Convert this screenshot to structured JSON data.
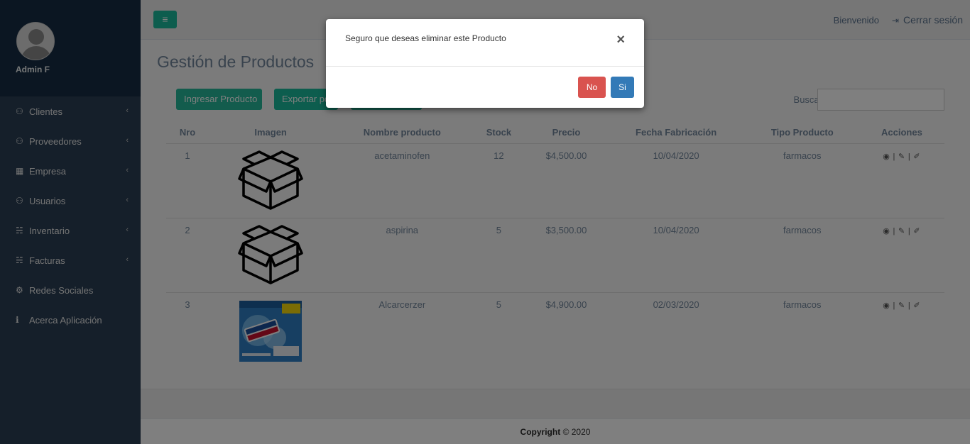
{
  "sidebar": {
    "user_name": "Admin F",
    "items": [
      {
        "label": "Clientes",
        "icon": "user-icon",
        "glyph": "⚇",
        "chevron": "‹"
      },
      {
        "label": "Proveedores",
        "icon": "user-icon",
        "glyph": "⚇",
        "chevron": "‹"
      },
      {
        "label": "Empresa",
        "icon": "building-icon",
        "glyph": "▦",
        "chevron": "‹"
      },
      {
        "label": "Usuarios",
        "icon": "user-icon",
        "glyph": "⚇",
        "chevron": "‹"
      },
      {
        "label": "Inventario",
        "icon": "cart-icon",
        "glyph": "☵",
        "chevron": "‹"
      },
      {
        "label": "Facturas",
        "icon": "cart-icon",
        "glyph": "☵",
        "chevron": "‹"
      },
      {
        "label": "Redes Sociales",
        "icon": "gear-icon",
        "glyph": "⚙",
        "chevron": ""
      },
      {
        "label": "Acerca Aplicación",
        "icon": "info-icon",
        "glyph": "ℹ",
        "chevron": ""
      }
    ]
  },
  "topbar": {
    "toggle_glyph": "≡",
    "welcome": "Bienvenido",
    "logout_glyph": "⇥",
    "logout": "Cerrar sesión"
  },
  "page": {
    "title": "Gestión de Productos",
    "btn_add": "Ingresar Producto",
    "btn_export": "Exportar pdf",
    "btn_other": "",
    "search_label": "Buscar",
    "search_value": ""
  },
  "table": {
    "headers": [
      "Nro",
      "Imagen",
      "Nombre producto",
      "Stock",
      "Precio",
      "Fecha Fabricación",
      "Tipo Producto",
      "Acciones"
    ],
    "rows": [
      {
        "nro": "1",
        "image": "box-icon",
        "name": "acetaminofen",
        "stock": "12",
        "price": "$4,500.00",
        "date": "10/04/2020",
        "type": "farmacos"
      },
      {
        "nro": "2",
        "image": "box-icon",
        "name": "aspirina",
        "stock": "5",
        "price": "$3,500.00",
        "date": "10/04/2020",
        "type": "farmacos"
      },
      {
        "nro": "3",
        "image": "product-photo",
        "name": "Alcarcerzer",
        "stock": "5",
        "price": "$4,900.00",
        "date": "02/03/2020",
        "type": "farmacos"
      }
    ],
    "actions": {
      "view": "◉",
      "edit": "✎",
      "delete": "✐",
      "sep": "|"
    }
  },
  "footer": {
    "copyright": "Copyright",
    "year": "© 2020"
  },
  "modal": {
    "message": "Seguro que deseas eliminar este Producto",
    "close": "×",
    "no": "No",
    "si": "Si"
  },
  "colors": {
    "sidebar": "#2a3f54",
    "accent": "#1abb9c",
    "danger": "#d9534f",
    "primary": "#337ab7"
  }
}
